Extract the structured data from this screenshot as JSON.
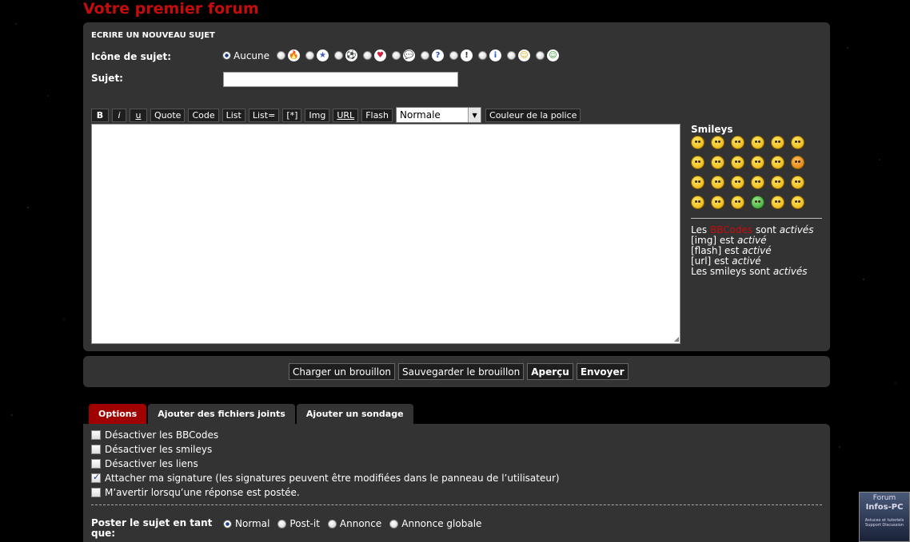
{
  "page": {
    "title": "Votre premier forum"
  },
  "post_panel": {
    "section_title": "ECRIRE UN NOUVEAU SUJET",
    "topic_icon_label": "Icône de sujet:",
    "topic_icon_none": "Aucune",
    "topic_icons": [
      {
        "name": "fire-icon",
        "glyph": "🔥",
        "color": "#e04010"
      },
      {
        "name": "star-icon",
        "glyph": "★",
        "color": "#4060c0"
      },
      {
        "name": "soccer-ball-icon",
        "glyph": "⚽",
        "color": "#3050b0"
      },
      {
        "name": "heart-icon",
        "glyph": "♥",
        "color": "#d02040"
      },
      {
        "name": "speech-bubble-icon",
        "glyph": "💬",
        "color": "#2a70c0"
      },
      {
        "name": "question-icon",
        "glyph": "?",
        "color": "#2050b0"
      },
      {
        "name": "warning-icon",
        "glyph": "!",
        "color": "#303030"
      },
      {
        "name": "info-icon",
        "glyph": "i",
        "color": "#2060c0"
      },
      {
        "name": "smiley-icon",
        "glyph": "☺",
        "color": "#e0a000"
      },
      {
        "name": "green-smiley-icon",
        "glyph": "☺",
        "color": "#20a020"
      }
    ],
    "subject_label": "Sujet:",
    "subject_value": ""
  },
  "toolbar": {
    "bold": "B",
    "italic": "i",
    "underline": "u",
    "quote": "Quote",
    "code": "Code",
    "list": "List",
    "list_eq": "List=",
    "list_item": "[*]",
    "img": "Img",
    "url": "URL",
    "flash": "Flash",
    "size_selected": "Normale",
    "font_color": "Couleur de la police"
  },
  "smileys": {
    "title": "Smileys",
    "count": 24
  },
  "bbcode_status": {
    "line1_prefix": "Les ",
    "line1_link": "BBCodes",
    "line1_mid": " sont ",
    "line1_state": "activés",
    "line2_prefix": "[img] est ",
    "line2_state": "activé",
    "line3_prefix": "[flash] est ",
    "line3_state": "activé",
    "line4_prefix": "[url] est ",
    "line4_state": "activé",
    "line5_prefix": "Les smileys sont ",
    "line5_state": "activés"
  },
  "actions": {
    "load_draft": "Charger un brouillon",
    "save_draft": "Sauvegarder le brouillon",
    "preview": "Aperçu",
    "submit": "Envoyer"
  },
  "tabs": {
    "options": "Options",
    "attachments": "Ajouter des fichiers joints",
    "poll": "Ajouter un sondage"
  },
  "options": {
    "disable_bbcode": "Désactiver les BBCodes",
    "disable_smileys": "Désactiver les smileys",
    "disable_links": "Désactiver les liens",
    "attach_signature": "Attacher ma signature (les signatures peuvent être modifiées dans le panneau de l’utilisateur)",
    "notify": "M’avertir lorsqu’une réponse est postée."
  },
  "post_as": {
    "label": "Poster le sujet en tant que:",
    "normal": "Normal",
    "postit": "Post-it",
    "announce": "Annonce",
    "global": "Annonce globale"
  },
  "badge": {
    "line1": "Forum",
    "line2": "Infos-PC",
    "line3": "Astuces et tutoriels Support Discussion"
  }
}
